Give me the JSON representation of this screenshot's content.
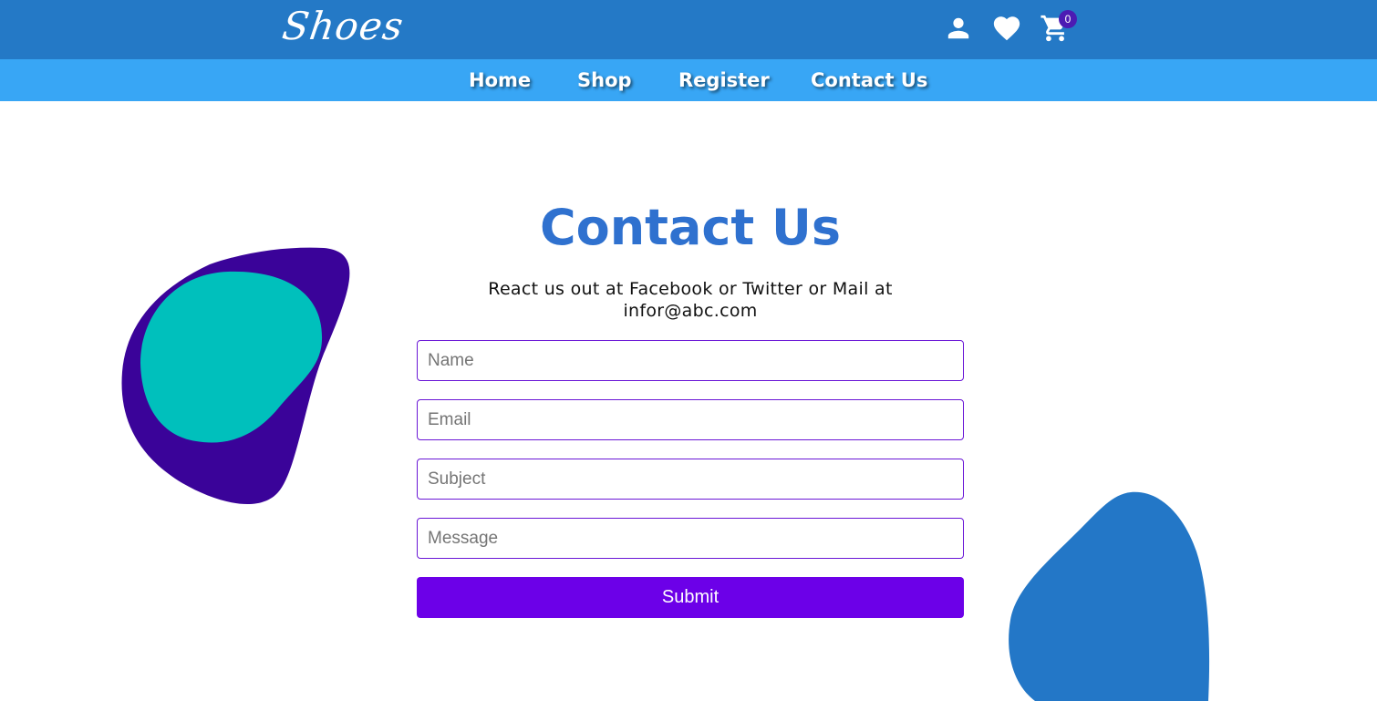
{
  "header": {
    "logo": "Shoes",
    "icons": [
      "user-icon",
      "heart-icon",
      "cart-icon"
    ],
    "cart_count": "0"
  },
  "nav": {
    "items": [
      {
        "label": "Home"
      },
      {
        "label": "Shop"
      },
      {
        "label": "Register"
      },
      {
        "label": "Contact Us"
      }
    ]
  },
  "contact": {
    "title": "Contact Us",
    "subtitle": "React us out at Facebook or Twitter or Mail at infor@abc.com",
    "name_placeholder": "Name",
    "email_placeholder": "Email",
    "subject_placeholder": "Subject",
    "message_placeholder": "Message",
    "submit_label": "Submit"
  },
  "colors": {
    "topbar": "#2479c6",
    "navbar": "#38a6f5",
    "title": "#2f71cf",
    "field_border": "#6a16d6",
    "submit": "#6c00e8",
    "blob_dark": "#3a0399",
    "blob_teal": "#00c0bc",
    "blob_blue": "#2377c7"
  }
}
